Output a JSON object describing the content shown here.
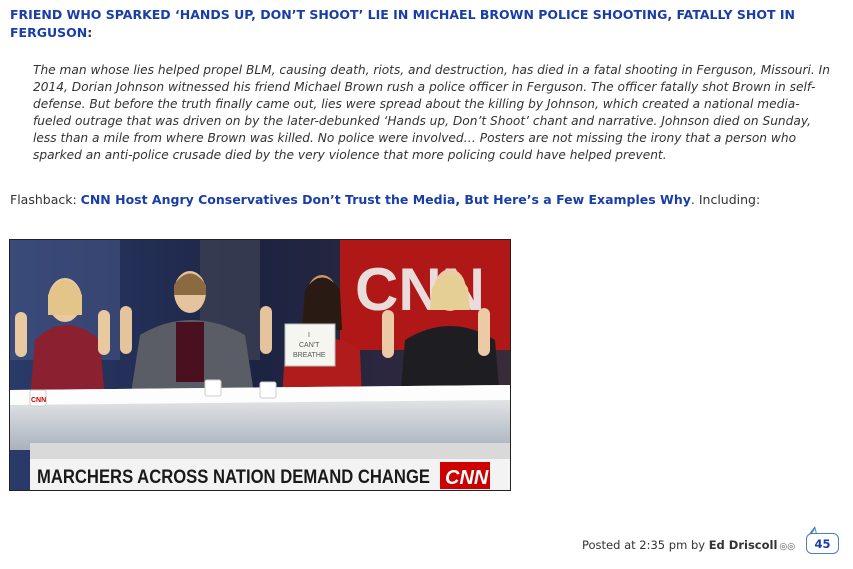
{
  "headline": {
    "link_text": "FRIEND WHO SPARKED ‘HANDS UP, DON’T SHOOT’ LIE IN MICHAEL BROWN POLICE SHOOTING, FATALLY SHOT IN FERGUSON",
    "suffix": ":"
  },
  "quote": {
    "text": "The man whose lies helped propel BLM, causing death, riots, and destruction, has died in a fatal shooting in Ferguson, Missouri. In 2014, Dorian Johnson witnessed his friend Michael Brown rush a police officer in Ferguson. The officer fatally shot Brown in self-defense. But before the truth finally came out, lies were spread about the killing by Johnson, which created a national media-fueled outrage that was driven on by the later-debunked ‘Hands up, Don’t Shoot’ chant and narrative. Johnson died on Sunday, less than a mile from where Brown was killed. No police were involved… Posters are not missing the irony that a person who sparked an anti-police crusade died by the very violence that more policing could have helped prevent."
  },
  "flashback": {
    "prefix": "Flashback: ",
    "link_text": "CNN Host Angry Conservatives Don’t Trust the Media, But Here’s a Few Examples Why",
    "suffix": ". Including:"
  },
  "photo": {
    "chyron_text": "MARCHERS ACROSS NATION DEMAND CHANGE",
    "logo_text": "CNN",
    "sign_text_line1": "I",
    "sign_text_line2": "CAN'T",
    "sign_text_line3": "BREATHE",
    "mug_text": "CNN",
    "background_logo_text": "CNN"
  },
  "footer": {
    "posted_prefix": "Posted at 2:35 pm by ",
    "author": "Ed Driscoll",
    "comment_count": "45"
  },
  "colors": {
    "link": "#1a3ea8",
    "cnn_red": "#cc0000",
    "bubble_border": "#4a7ec4"
  }
}
